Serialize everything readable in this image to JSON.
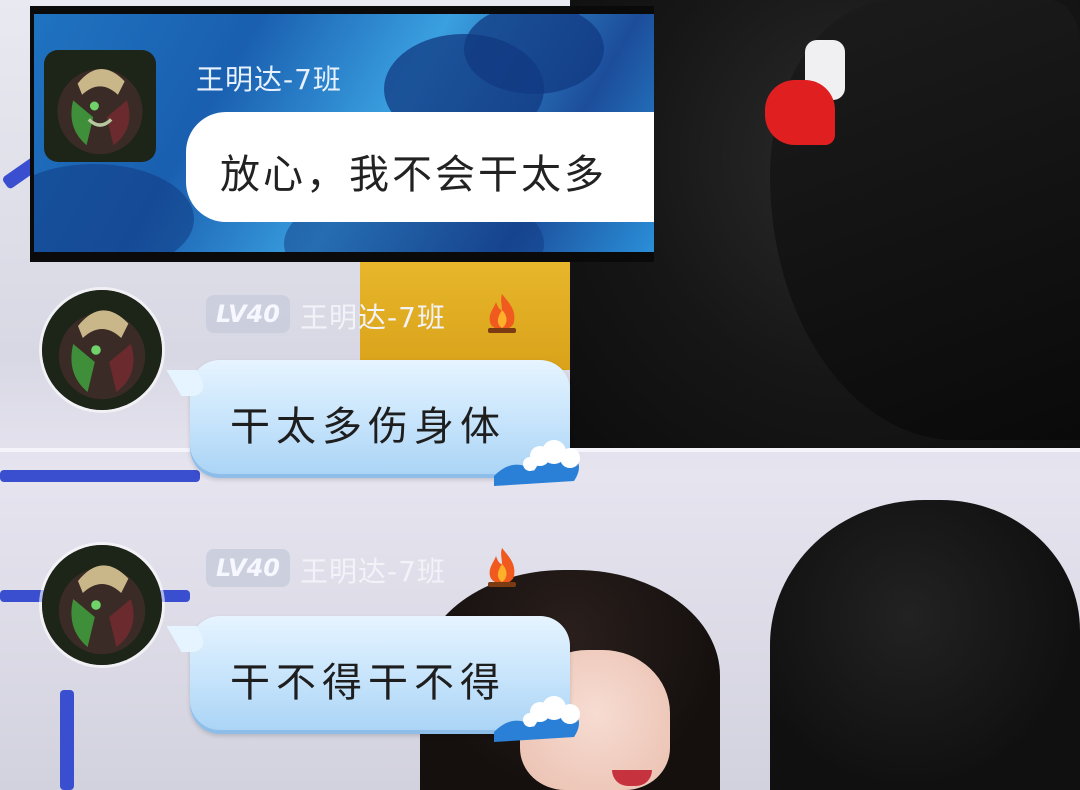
{
  "top_card": {
    "username": "王明达-7班",
    "message": "放心，我不会干太多"
  },
  "messages": [
    {
      "level": "LV40",
      "username": "王明达-7班",
      "text": "干太多伤身体"
    },
    {
      "level": "LV40",
      "username": "王明达-7班",
      "text": "干不得干不得"
    }
  ],
  "icons": {
    "avatar": "hero-avatar-icon",
    "badge": "fire-icon",
    "bubble_decoration": "wave-icon"
  },
  "colors": {
    "bubble_top": "#e6f4ff",
    "bubble_bottom": "#a9d3f5",
    "card_bg": "#1f73c0",
    "level_badge": "#c8cddc",
    "fire": "#f05a1e"
  }
}
